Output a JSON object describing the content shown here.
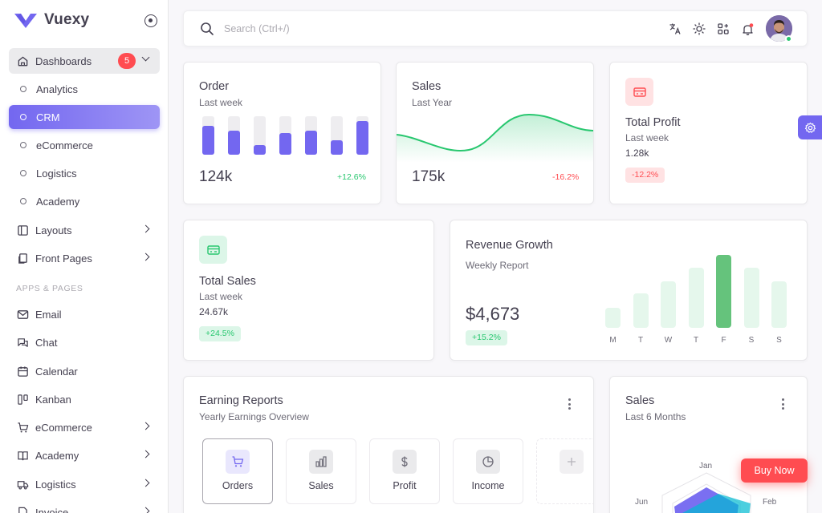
{
  "brand": {
    "name": "Vuexy"
  },
  "sidebar": {
    "dashboards": {
      "label": "Dashboards",
      "badge": "5"
    },
    "sub_items": [
      {
        "label": "Analytics"
      },
      {
        "label": "CRM"
      },
      {
        "label": "eCommerce"
      },
      {
        "label": "Logistics"
      },
      {
        "label": "Academy"
      }
    ],
    "layouts": {
      "label": "Layouts"
    },
    "front_pages": {
      "label": "Front Pages"
    },
    "section_title": "APPS & PAGES",
    "apps": [
      {
        "label": "Email"
      },
      {
        "label": "Chat"
      },
      {
        "label": "Calendar"
      },
      {
        "label": "Kanban"
      },
      {
        "label": "eCommerce"
      },
      {
        "label": "Academy"
      },
      {
        "label": "Logistics"
      },
      {
        "label": "Invoice"
      }
    ]
  },
  "search": {
    "placeholder": "Search (Ctrl+/)"
  },
  "order_card": {
    "title": "Order",
    "subtitle": "Last week",
    "value": "124k",
    "change": "+12.6%",
    "bars": [
      0.75,
      0.62,
      0.25,
      0.56,
      0.62,
      0.37,
      0.88
    ]
  },
  "sales_card": {
    "title": "Sales",
    "subtitle": "Last Year",
    "value": "175k",
    "change": "-16.2%"
  },
  "profit_card": {
    "title": "Total Profit",
    "subtitle": "Last week",
    "value": "1.28k",
    "change": "-12.2%"
  },
  "total_sales_card": {
    "title": "Total Sales",
    "subtitle": "Last week",
    "value": "24.67k",
    "change": "+24.5%"
  },
  "revenue_card": {
    "title": "Revenue Growth",
    "subtitle": "Weekly Report",
    "value": "$4,673",
    "change": "+15.2%",
    "days": [
      "M",
      "T",
      "W",
      "T",
      "F",
      "S",
      "S"
    ],
    "bars": [
      0.28,
      0.47,
      0.64,
      0.82,
      1.0,
      0.82,
      0.64
    ],
    "highlight_index": 4
  },
  "earning_card": {
    "title": "Earning Reports",
    "subtitle": "Yearly Earnings Overview",
    "tabs": [
      {
        "label": "Orders"
      },
      {
        "label": "Sales"
      },
      {
        "label": "Profit"
      },
      {
        "label": "Income"
      }
    ]
  },
  "sales6_card": {
    "title": "Sales",
    "subtitle": "Last 6 Months",
    "labels": [
      "Jan",
      "Jun",
      "Feb"
    ]
  },
  "buy_now": {
    "label": "Buy Now"
  },
  "colors": {
    "primary": "#7367f0",
    "success": "#28c76f",
    "danger": "#ff4c51"
  }
}
